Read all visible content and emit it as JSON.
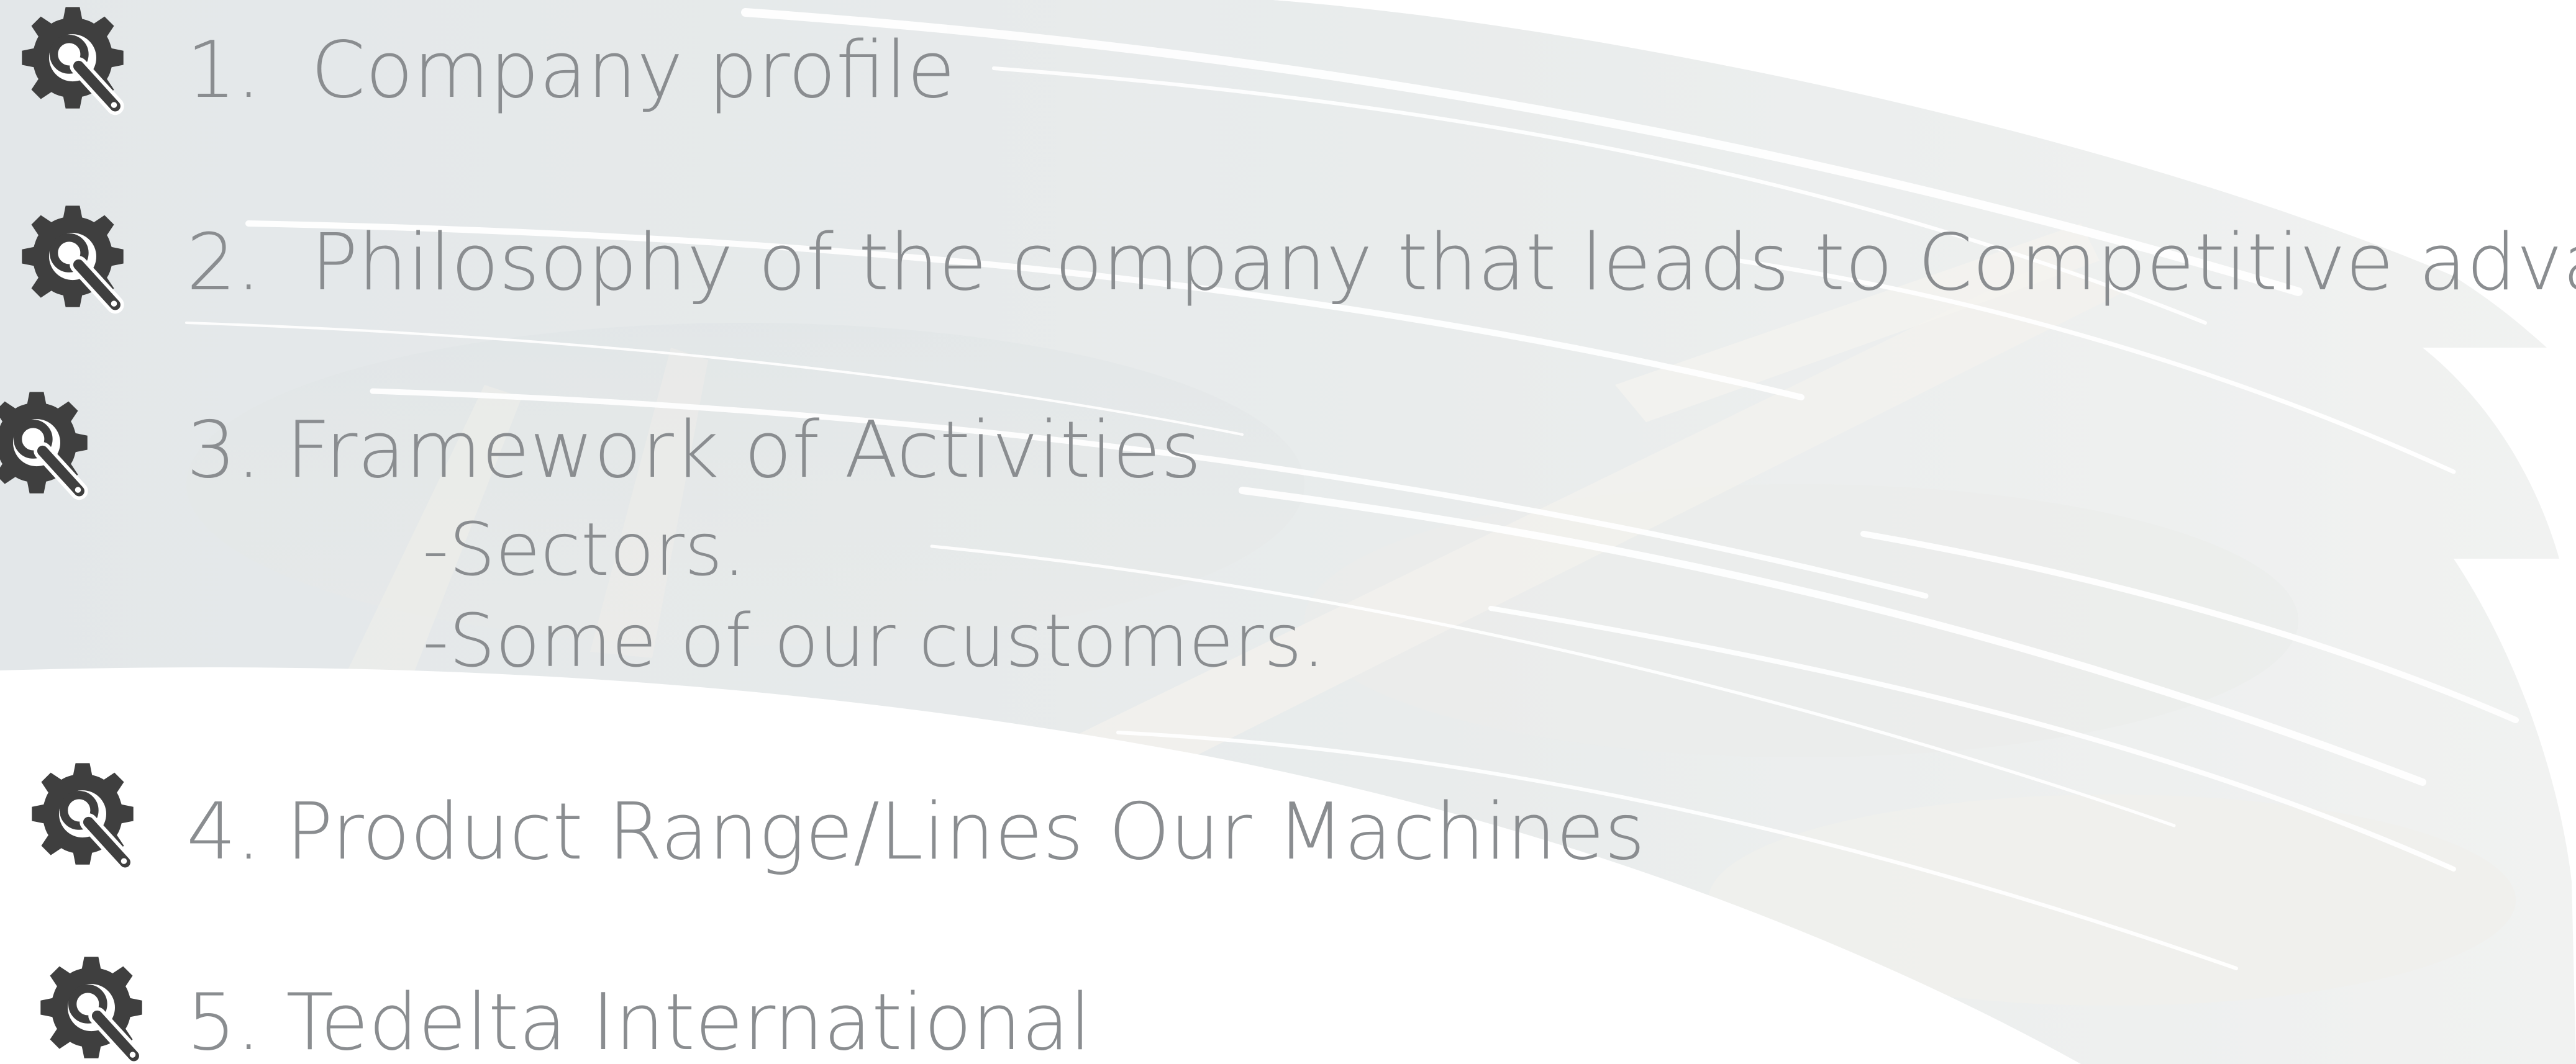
{
  "agenda": {
    "items": [
      {
        "number": "1.",
        "label": "Company profile",
        "icon": "gear-wrench-icon"
      },
      {
        "number": "2.",
        "label": "Philosophy of the company that leads to Competitive advantages",
        "icon": "gear-wrench-icon"
      },
      {
        "number": "3.",
        "label": "Framework of Activities",
        "icon": "gear-wrench-icon",
        "subitems": [
          "-Sectors.",
          "-Some of our customers."
        ]
      },
      {
        "number": "4.",
        "label": "Product Range/Lines Our Machines",
        "icon": "gear-wrench-icon"
      },
      {
        "number": "5.",
        "label": "Tedelta International",
        "icon": "gear-wrench-icon"
      }
    ]
  },
  "colors": {
    "text": "#8a8d90",
    "icon": "#3f3f3f",
    "brush": "#e6eaec",
    "background": "#ffffff"
  }
}
